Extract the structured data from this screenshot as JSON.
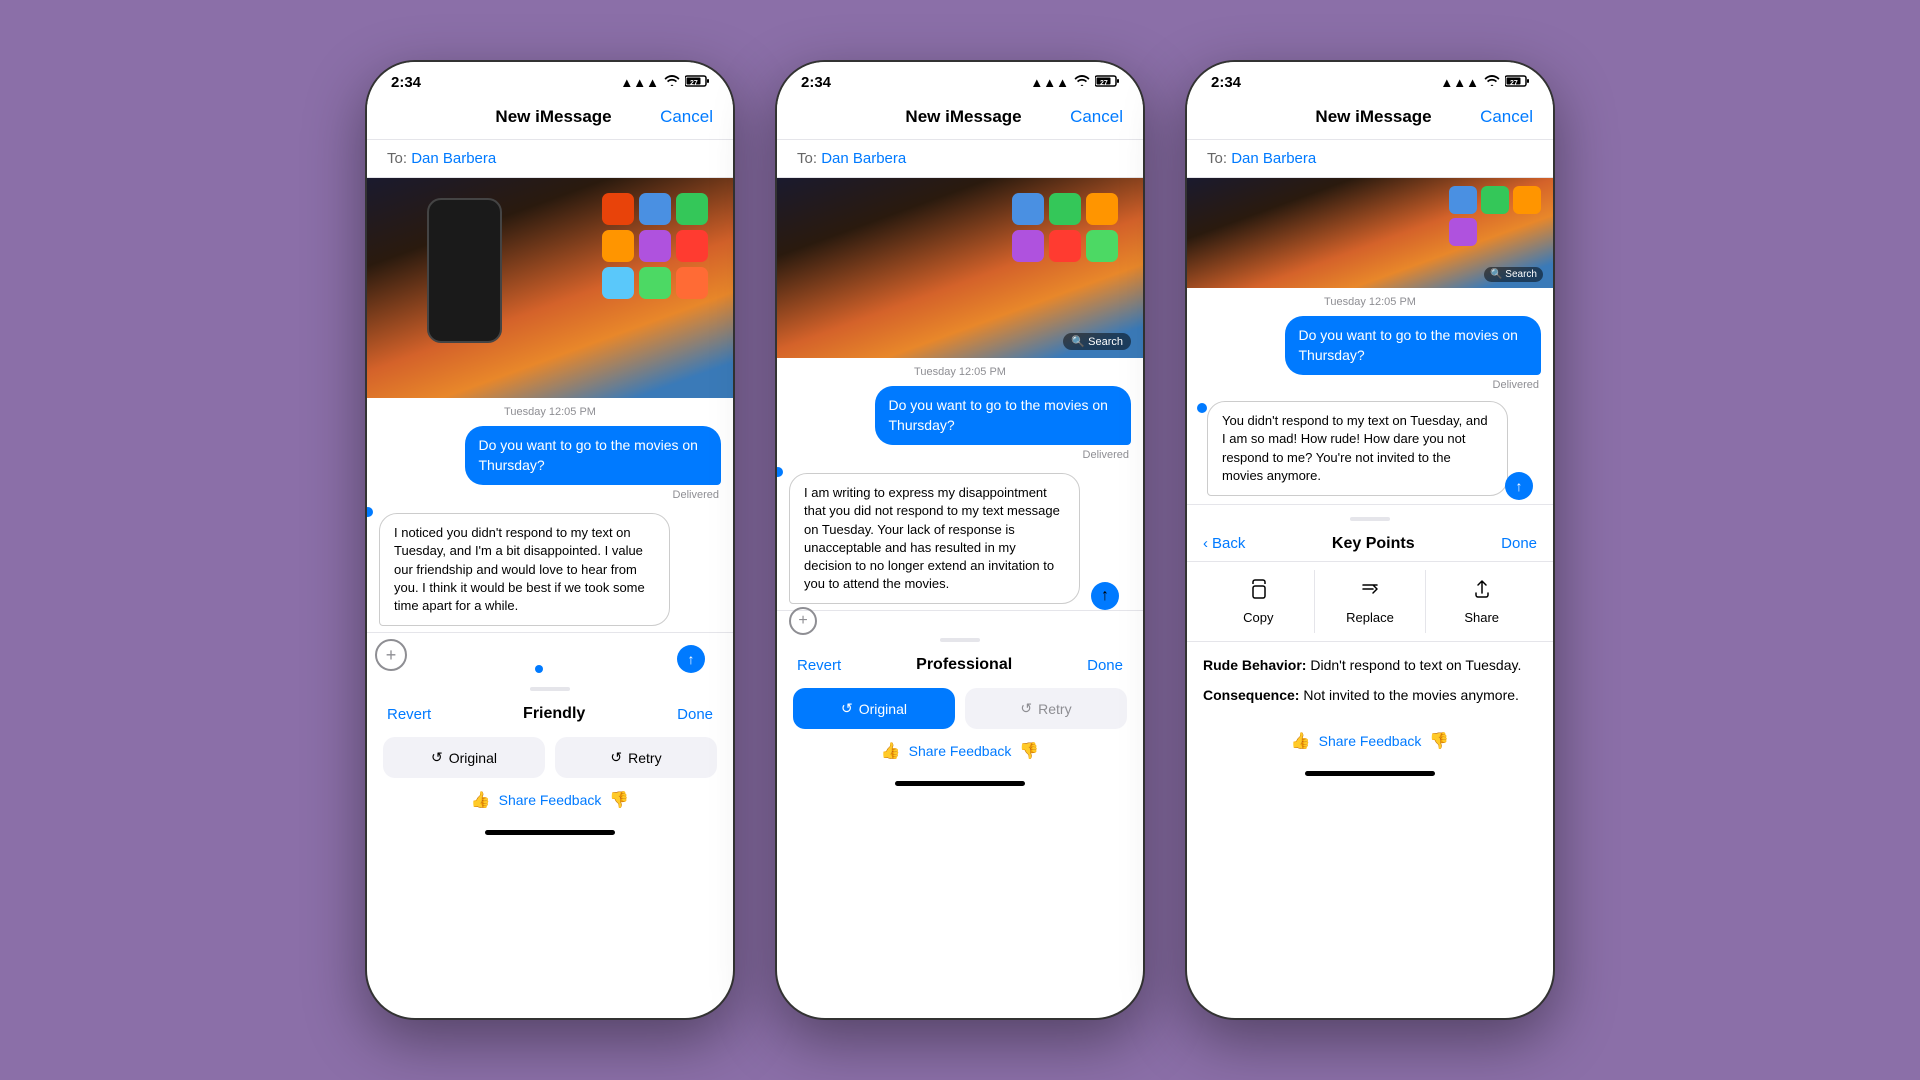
{
  "background_color": "#8B6FA8",
  "phones": [
    {
      "id": "phone1",
      "status_bar": {
        "time": "2:34",
        "battery_icon": "🔋",
        "signal": "▲▲▲",
        "wifi": "wifi",
        "battery": "27"
      },
      "header": {
        "title": "New iMessage",
        "cancel_label": "Cancel"
      },
      "to_field": {
        "label": "To:",
        "name": "Dan Barbera"
      },
      "timestamp": "Tuesday 12:05 PM",
      "messages": [
        {
          "type": "out",
          "text": "Do you want to go to the movies on Thursday?",
          "status": "Delivered"
        },
        {
          "type": "in",
          "text": "I noticed you didn't respond to my text on Tuesday, and I'm a bit disappointed. I value our friendship and would love to hear from you. I think it would be best if we took some time apart for a while.",
          "editing": true
        }
      ],
      "mode_switcher": {
        "revert": "Revert",
        "label": "Friendly",
        "done": "Done"
      },
      "buttons": [
        {
          "label": "Original",
          "icon": "↺",
          "style": "normal"
        },
        {
          "label": "Retry",
          "icon": "↺",
          "style": "normal"
        }
      ],
      "feedback": {
        "label": "Share Feedback"
      }
    },
    {
      "id": "phone2",
      "status_bar": {
        "time": "2:34",
        "battery_icon": "🔋",
        "signal": "▲▲▲",
        "wifi": "wifi",
        "battery": "27"
      },
      "header": {
        "title": "New iMessage",
        "cancel_label": "Cancel"
      },
      "to_field": {
        "label": "To:",
        "name": "Dan Barbera"
      },
      "timestamp": "Tuesday 12:05 PM",
      "messages": [
        {
          "type": "out",
          "text": "Do you want to go to the movies on Thursday?",
          "status": "Delivered"
        },
        {
          "type": "in",
          "text": "I am writing to express my disappointment that you did not respond to my text message on Tuesday. Your lack of response is unacceptable and has resulted in my decision to no longer extend an invitation to you to attend the movies.",
          "editing": true
        }
      ],
      "mode_switcher": {
        "revert": "Revert",
        "label": "Professional",
        "done": "Done"
      },
      "buttons": [
        {
          "label": "Original",
          "icon": "↺",
          "style": "active"
        },
        {
          "label": "Retry",
          "icon": "↺",
          "style": "disabled"
        }
      ],
      "feedback": {
        "label": "Share Feedback"
      }
    },
    {
      "id": "phone3",
      "status_bar": {
        "time": "2:34",
        "battery_icon": "🔋",
        "signal": "▲▲▲",
        "wifi": "wifi",
        "battery": "27"
      },
      "header": {
        "title": "New iMessage",
        "cancel_label": "Cancel"
      },
      "to_field": {
        "label": "To:",
        "name": "Dan Barbera"
      },
      "timestamp": "Tuesday 12:05 PM",
      "messages": [
        {
          "type": "out",
          "text": "Do you want to go to the movies on Thursday?",
          "status": "Delivered"
        },
        {
          "type": "in_editing",
          "text": "You didn't respond to my text on Tuesday, and I am so mad! How rude! How dare you not respond to me? You're not invited to the movies anymore."
        }
      ],
      "key_points": {
        "back_label": "Back",
        "title": "Key Points",
        "done_label": "Done",
        "actions": [
          {
            "icon": "📋",
            "label": "Copy"
          },
          {
            "icon": "⇄",
            "label": "Replace"
          },
          {
            "icon": "↑",
            "label": "Share"
          }
        ],
        "bullets": [
          {
            "term": "Rude Behavior:",
            "text": "Didn't respond to text on Tuesday."
          },
          {
            "term": "Consequence:",
            "text": "Not invited to the movies anymore."
          }
        ]
      },
      "feedback": {
        "label": "Share Feedback"
      }
    }
  ]
}
